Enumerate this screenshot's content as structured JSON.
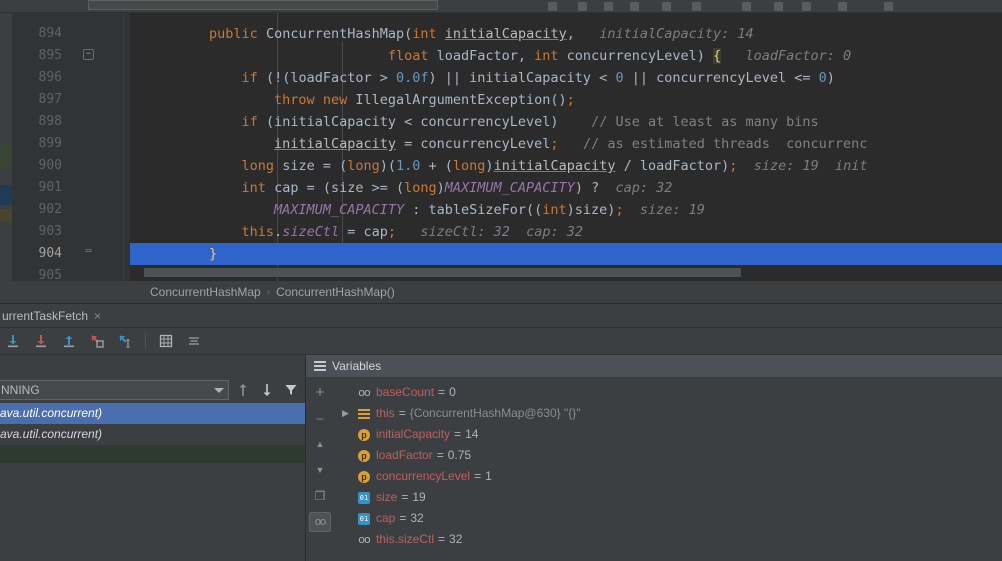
{
  "app": {
    "theme_bg": "#3c3f41",
    "editor_bg": "#2b2b2b",
    "accent": "#4b6eaf",
    "highlight_line_bg": "#2f65ca"
  },
  "editor": {
    "line_numbers": [
      "894",
      "895",
      "896",
      "897",
      "898",
      "899",
      "900",
      "901",
      "902",
      "903",
      "904",
      "905"
    ],
    "current_line": "904",
    "lines": [
      {
        "num": "894",
        "tokens": [
          {
            "t": "        ",
            "c": "punc"
          },
          {
            "t": "public",
            "c": "kw"
          },
          {
            "t": " ",
            "c": "punc"
          },
          {
            "t": "ConcurrentHashMap",
            "c": "cls"
          },
          {
            "t": "(",
            "c": "punc"
          },
          {
            "t": "int",
            "c": "kw"
          },
          {
            "t": " ",
            "c": "punc"
          },
          {
            "t": "initialCapacity",
            "c": "under"
          },
          {
            "t": ",",
            "c": "punc"
          },
          {
            "t": "   ",
            "c": "punc"
          },
          {
            "t": "initialCapacity: 14",
            "c": "hint"
          }
        ]
      },
      {
        "num": "895",
        "tokens": [
          {
            "t": "                              ",
            "c": "punc"
          },
          {
            "t": "float",
            "c": "kw"
          },
          {
            "t": " loadFactor, ",
            "c": "punc"
          },
          {
            "t": "int",
            "c": "kw"
          },
          {
            "t": " concurrencyLevel) ",
            "c": "punc"
          },
          {
            "t": "{",
            "c": "brace-hl"
          },
          {
            "t": "   ",
            "c": "punc"
          },
          {
            "t": "loadFactor: 0",
            "c": "hint"
          }
        ]
      },
      {
        "num": "896",
        "tokens": [
          {
            "t": "            ",
            "c": "punc"
          },
          {
            "t": "if",
            "c": "kw"
          },
          {
            "t": " (!(loadFactor > ",
            "c": "punc"
          },
          {
            "t": "0.0f",
            "c": "num"
          },
          {
            "t": ") || initialCapacity < ",
            "c": "punc"
          },
          {
            "t": "0",
            "c": "num"
          },
          {
            "t": " || concurrencyLevel <= ",
            "c": "punc"
          },
          {
            "t": "0",
            "c": "num"
          },
          {
            "t": ")",
            "c": "punc"
          }
        ]
      },
      {
        "num": "897",
        "tokens": [
          {
            "t": "                ",
            "c": "punc"
          },
          {
            "t": "throw",
            "c": "kw"
          },
          {
            "t": " ",
            "c": "punc"
          },
          {
            "t": "new",
            "c": "kw"
          },
          {
            "t": " IllegalArgumentException()",
            "c": "punc"
          },
          {
            "t": ";",
            "c": "semi"
          }
        ]
      },
      {
        "num": "898",
        "tokens": [
          {
            "t": "            ",
            "c": "punc"
          },
          {
            "t": "if",
            "c": "kw"
          },
          {
            "t": " (initialCapacity < concurrencyLevel)",
            "c": "punc"
          },
          {
            "t": "    ",
            "c": "punc"
          },
          {
            "t": "// Use at least as many bins",
            "c": "cmt"
          }
        ]
      },
      {
        "num": "899",
        "tokens": [
          {
            "t": "                ",
            "c": "punc"
          },
          {
            "t": "initialCapacity",
            "c": "under"
          },
          {
            "t": " = concurrencyLevel",
            "c": "punc"
          },
          {
            "t": ";",
            "c": "semi"
          },
          {
            "t": "   ",
            "c": "punc"
          },
          {
            "t": "// as estimated threads  concurrenc",
            "c": "cmt"
          }
        ]
      },
      {
        "num": "900",
        "tokens": [
          {
            "t": "            ",
            "c": "punc"
          },
          {
            "t": "long",
            "c": "kw"
          },
          {
            "t": " size = (",
            "c": "punc"
          },
          {
            "t": "long",
            "c": "kw"
          },
          {
            "t": ")(",
            "c": "punc"
          },
          {
            "t": "1.0",
            "c": "num"
          },
          {
            "t": " + (",
            "c": "punc"
          },
          {
            "t": "long",
            "c": "kw"
          },
          {
            "t": ")",
            "c": "punc"
          },
          {
            "t": "initialCapacity",
            "c": "under"
          },
          {
            "t": " / loadFactor)",
            "c": "punc"
          },
          {
            "t": ";",
            "c": "semi"
          },
          {
            "t": "  ",
            "c": "punc"
          },
          {
            "t": "size: 19  init",
            "c": "hint"
          }
        ]
      },
      {
        "num": "901",
        "tokens": [
          {
            "t": "            ",
            "c": "punc"
          },
          {
            "t": "int",
            "c": "kw"
          },
          {
            "t": " cap = (size >= (",
            "c": "punc"
          },
          {
            "t": "long",
            "c": "kw"
          },
          {
            "t": ")",
            "c": "punc"
          },
          {
            "t": "MAXIMUM_CAPACITY",
            "c": "fld"
          },
          {
            "t": ") ?",
            "c": "punc"
          },
          {
            "t": "  ",
            "c": "punc"
          },
          {
            "t": "cap: 32",
            "c": "hint"
          }
        ]
      },
      {
        "num": "902",
        "tokens": [
          {
            "t": "                ",
            "c": "punc"
          },
          {
            "t": "MAXIMUM_CAPACITY",
            "c": "fld"
          },
          {
            "t": " : tableSizeFor((",
            "c": "punc"
          },
          {
            "t": "int",
            "c": "kw"
          },
          {
            "t": ")size)",
            "c": "punc"
          },
          {
            "t": ";",
            "c": "semi"
          },
          {
            "t": "  ",
            "c": "punc"
          },
          {
            "t": "size: 19",
            "c": "hint"
          }
        ]
      },
      {
        "num": "903",
        "tokens": [
          {
            "t": "            ",
            "c": "punc"
          },
          {
            "t": "this",
            "c": "kw"
          },
          {
            "t": ".",
            "c": "punc"
          },
          {
            "t": "sizeCtl",
            "c": "fld"
          },
          {
            "t": " = cap",
            "c": "punc"
          },
          {
            "t": ";",
            "c": "semi"
          },
          {
            "t": "   ",
            "c": "punc"
          },
          {
            "t": "sizeCtl: 32  cap: 32",
            "c": "hint"
          }
        ]
      },
      {
        "num": "904",
        "highlighted": true,
        "tokens": [
          {
            "t": "        ",
            "c": "punc"
          },
          {
            "t": "}",
            "c": "yellowbrace"
          }
        ]
      },
      {
        "num": "905",
        "tokens": []
      }
    ]
  },
  "breadcrumb": {
    "items": [
      "ConcurrentHashMap",
      "ConcurrentHashMap()"
    ],
    "separator": "›"
  },
  "debug": {
    "tab_label": "urrentTaskFetch",
    "tab_close": "×",
    "toolbar": [
      {
        "name": "step-over-button",
        "title": "Step Over"
      },
      {
        "name": "step-into-button",
        "title": "Step Into"
      },
      {
        "name": "step-out-button",
        "title": "Step Out"
      },
      {
        "name": "force-step-into-button",
        "title": "Force Step Into"
      },
      {
        "name": "run-to-cursor-button",
        "title": "Run to Cursor"
      },
      {
        "name": "evaluate-expression-button",
        "title": "Evaluate Expression"
      },
      {
        "name": "show-execution-point-button",
        "title": "Show Execution Point"
      }
    ]
  },
  "frames": {
    "thread_label": "NNING",
    "frames": [
      {
        "label": "ava.util.concurrent)",
        "selected": true
      },
      {
        "label": "ava.util.concurrent)",
        "selected": false
      }
    ]
  },
  "variables": {
    "title": "Variables",
    "side_buttons": [
      {
        "name": "add-watch-button",
        "glyph": "+"
      },
      {
        "name": "remove-watch-button",
        "glyph": "–"
      },
      {
        "name": "move-up-button",
        "glyph": "▲"
      },
      {
        "name": "move-down-button",
        "glyph": "▼"
      },
      {
        "name": "copy-value-button",
        "glyph": "❐"
      },
      {
        "name": "watches-toggle-button",
        "glyph": "oo",
        "active": true
      }
    ],
    "rows": [
      {
        "icon": "oo",
        "expandable": false,
        "name": "baseCount",
        "eq": "=",
        "value": "0",
        "value_kind": "prim"
      },
      {
        "icon": "lines",
        "expandable": true,
        "name": "this",
        "eq": "=",
        "value": "{ConcurrentHashMap@630} \"{}\"",
        "value_kind": "obj"
      },
      {
        "icon": "p",
        "expandable": false,
        "name": "initialCapacity",
        "eq": "=",
        "value": "14",
        "value_kind": "prim"
      },
      {
        "icon": "p",
        "expandable": false,
        "name": "loadFactor",
        "eq": "=",
        "value": "0.75",
        "value_kind": "prim"
      },
      {
        "icon": "p",
        "expandable": false,
        "name": "concurrencyLevel",
        "eq": "=",
        "value": "1",
        "value_kind": "prim"
      },
      {
        "icon": "sq",
        "expandable": false,
        "name": "size",
        "eq": "=",
        "value": "19",
        "value_kind": "prim"
      },
      {
        "icon": "sq",
        "expandable": false,
        "name": "cap",
        "eq": "=",
        "value": "32",
        "value_kind": "prim"
      },
      {
        "icon": "oo",
        "expandable": false,
        "name": "this.sizeCtl",
        "eq": "=",
        "value": "32",
        "value_kind": "prim"
      }
    ]
  }
}
